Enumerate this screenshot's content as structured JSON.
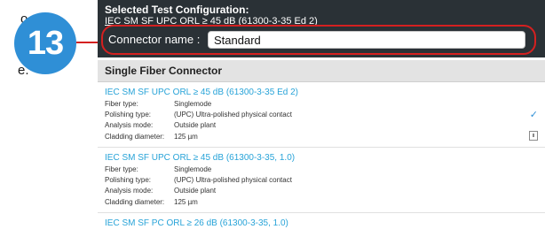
{
  "callout": {
    "number": "13"
  },
  "margin_fragments": [
    "o",
    "o",
    "e."
  ],
  "header": {
    "title": "Selected Test Configuration:",
    "subtitle": "IEC SM SF UPC ORL ≥ 45 dB (61300-3-35 Ed 2)",
    "connector_label": "Connector name :",
    "connector_value": "Standard"
  },
  "section": {
    "title": "Single Fiber Connector"
  },
  "items": [
    {
      "title": "IEC SM SF UPC ORL ≥ 45 dB (61300-3-35 Ed 2)",
      "fields": [
        {
          "key": "Fiber type:",
          "value": "Singlemode"
        },
        {
          "key": "Polishing type:",
          "value": "(UPC) Ultra-polished physical contact"
        },
        {
          "key": "Analysis mode:",
          "value": "Outside plant"
        },
        {
          "key": "Cladding diameter:",
          "value": "125 µm"
        }
      ],
      "selected": true,
      "check_icon": "✓"
    },
    {
      "title": "IEC SM SF UPC ORL ≥ 45 dB (61300-3-35, 1.0)",
      "fields": [
        {
          "key": "Fiber type:",
          "value": "Singlemode"
        },
        {
          "key": "Polishing type:",
          "value": "(UPC) Ultra-polished physical contact"
        },
        {
          "key": "Analysis mode:",
          "value": "Outside plant"
        },
        {
          "key": "Cladding diameter:",
          "value": "125 µm"
        }
      ]
    },
    {
      "title": "IEC SM SF PC ORL ≥ 26 dB (61300-3-35, 1.0)"
    }
  ],
  "colors": {
    "header_bg": "#2a3136",
    "accent_blue": "#27a3d8",
    "callout_red": "#d42020",
    "badge_blue": "#2f8fd6"
  },
  "icons": {
    "selected": "check-icon",
    "export": "save-icon"
  }
}
